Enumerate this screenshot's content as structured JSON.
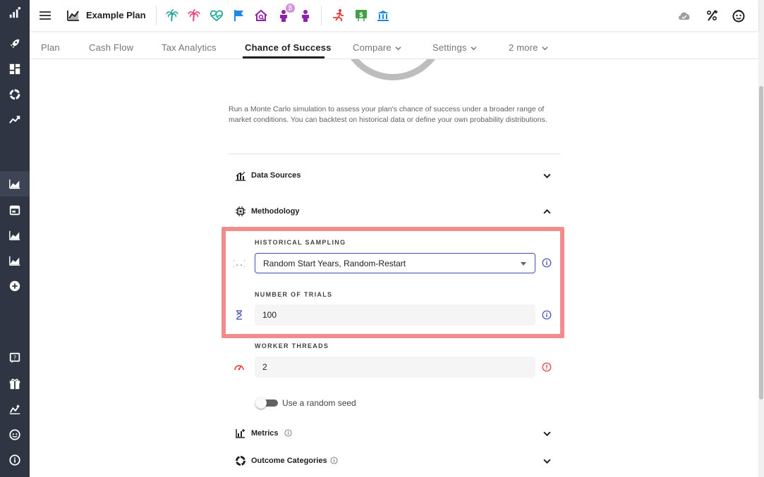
{
  "header": {
    "plan_title": "Example Plan",
    "icons": [
      "menu-icon",
      "plan-chart-icon",
      "palm-tree-icon",
      "palm-tree-icon",
      "heartbeat-icon",
      "flag-icon",
      "house-search-icon",
      "person-icon",
      "person-icon",
      "run-icon",
      "money-icon",
      "bank-icon",
      "cloud-icon",
      "percent-icon",
      "user-avatar-icon"
    ],
    "badge": "₿"
  },
  "tabs": [
    {
      "label": "Plan"
    },
    {
      "label": "Cash Flow"
    },
    {
      "label": "Tax Analytics"
    },
    {
      "label": "Chance of Success",
      "active": true
    },
    {
      "label": "Compare"
    },
    {
      "label": "Settings"
    },
    {
      "label": "2 more"
    }
  ],
  "intro": "Run a Monte Carlo simulation to assess your plan's chance of success under a broader range of market conditions. You can backtest on historical data or define your own probability distributions.",
  "sections": {
    "data_sources": "Data Sources",
    "methodology": "Methodology",
    "metrics": "Metrics",
    "outcome_categories": "Outcome Categories"
  },
  "fields": {
    "historical_sampling": {
      "label": "HISTORICAL SAMPLING",
      "value": "Random Start Years, Random-Restart"
    },
    "number_of_trials": {
      "label": "NUMBER OF TRIALS",
      "value": "100"
    },
    "worker_threads": {
      "label": "WORKER THREADS",
      "value": "2"
    }
  },
  "toggle": {
    "label": "Use a random seed",
    "on": false
  },
  "colors": {
    "rail": "#2f3542",
    "accent": "#3f51b5",
    "highlight": "#f28c8c",
    "teal": "#26a69a",
    "pink": "#ec407a",
    "purple": "#8e24aa",
    "blue": "#1e88e5",
    "red": "#e53935",
    "green": "#43a047"
  }
}
